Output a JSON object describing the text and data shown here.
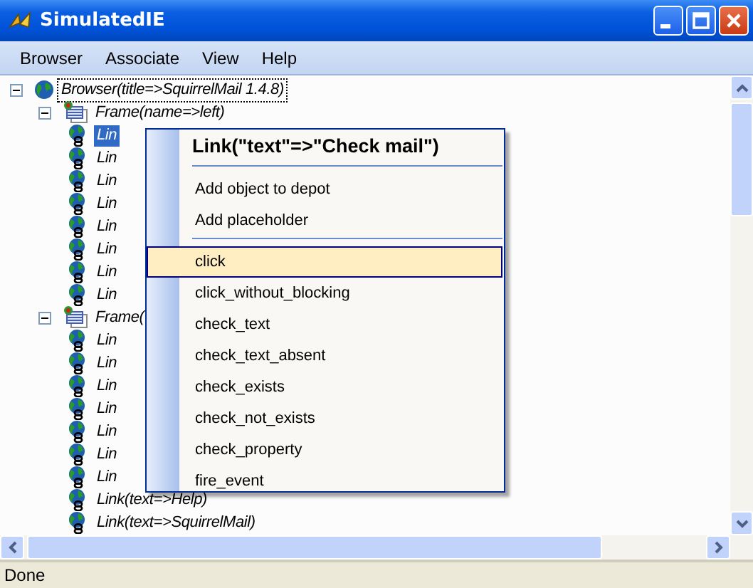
{
  "window": {
    "title": "SimulatedIE"
  },
  "menu_bar": [
    "Browser",
    "Associate",
    "View",
    "Help"
  ],
  "tree": [
    {
      "kind": "browser",
      "label": "Browser(title=>SquirrelMail 1.4.8)",
      "expanded": true,
      "selected": false,
      "children": [
        {
          "kind": "frame",
          "label": "Frame(name=>left)",
          "expanded": true,
          "selected": false,
          "children": [
            {
              "kind": "link",
              "label": "Lin",
              "selected": true
            },
            {
              "kind": "link",
              "label": "Lin",
              "selected": false
            },
            {
              "kind": "link",
              "label": "Lin",
              "selected": false
            },
            {
              "kind": "link",
              "label": "Lin",
              "selected": false
            },
            {
              "kind": "link",
              "label": "Lin",
              "selected": false
            },
            {
              "kind": "link",
              "label": "Lin",
              "selected": false
            },
            {
              "kind": "link",
              "label": "Lin",
              "selected": false
            },
            {
              "kind": "link",
              "label": "Lin",
              "selected": false
            }
          ]
        },
        {
          "kind": "frame",
          "label": "Frame(",
          "expanded": true,
          "selected": false,
          "children": [
            {
              "kind": "link",
              "label": "Lin",
              "selected": false
            },
            {
              "kind": "link",
              "label": "Lin",
              "selected": false
            },
            {
              "kind": "link",
              "label": "Lin",
              "selected": false
            },
            {
              "kind": "link",
              "label": "Lin",
              "selected": false
            },
            {
              "kind": "link",
              "label": "Lin",
              "selected": false
            },
            {
              "kind": "link",
              "label": "Lin",
              "selected": false
            },
            {
              "kind": "link",
              "label": "Lin",
              "selected": false
            },
            {
              "kind": "link",
              "label": "Link(text=>Help)",
              "selected": false
            },
            {
              "kind": "link",
              "label": "Link(text=>SquirrelMail)",
              "selected": false
            }
          ]
        }
      ]
    }
  ],
  "context_menu": {
    "title": "Link(\"text\"=>\"Check mail\")",
    "groups": [
      [
        {
          "label": "Add object to depot",
          "selected": false
        },
        {
          "label": "Add placeholder",
          "selected": false
        }
      ],
      [
        {
          "label": "click",
          "selected": true
        },
        {
          "label": "click_without_blocking",
          "selected": false
        },
        {
          "label": "check_text",
          "selected": false
        },
        {
          "label": "check_text_absent",
          "selected": false
        },
        {
          "label": "check_exists",
          "selected": false
        },
        {
          "label": "check_not_exists",
          "selected": false
        },
        {
          "label": "check_property",
          "selected": false
        },
        {
          "label": "fire_event",
          "selected": false
        }
      ]
    ]
  },
  "status_bar": {
    "text": "Done"
  }
}
